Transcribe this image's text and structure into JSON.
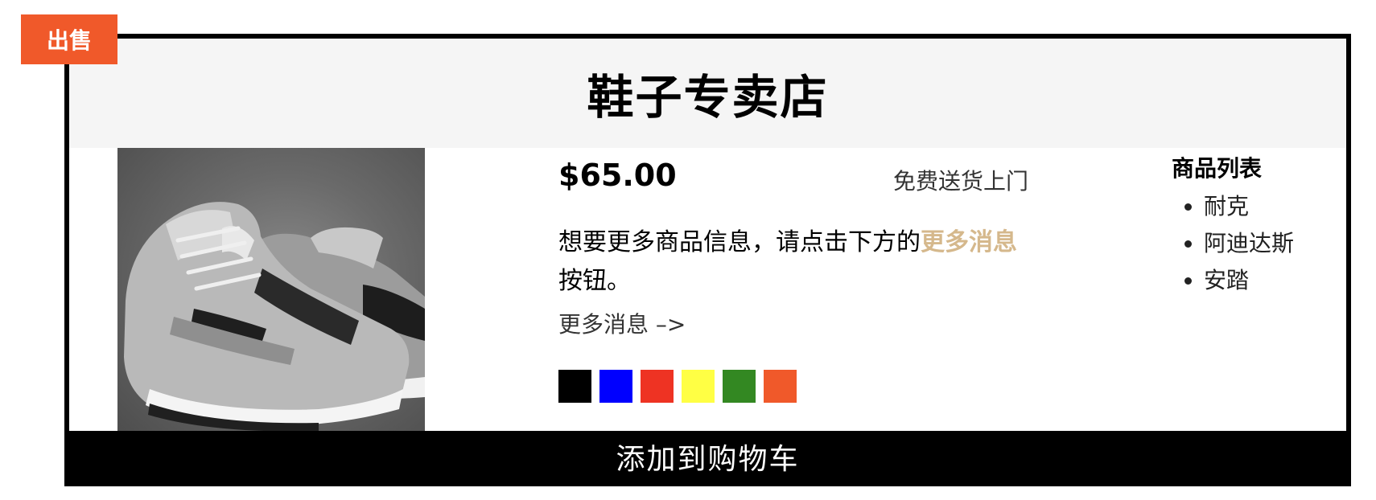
{
  "badge": {
    "label": "出售",
    "color": "#f0592a"
  },
  "store": {
    "title": "鞋子专卖店"
  },
  "product": {
    "price": "$65.00",
    "shipping": "免费送货上门",
    "description_before": "想要更多商品信息，请点击下方的",
    "description_highlight": "更多消息",
    "description_after": "按钮。",
    "more_link": "更多消息 –>",
    "swatches": [
      "#000000",
      "#0000ff",
      "#ee3323",
      "#ffff44",
      "#338822",
      "#f0592a"
    ]
  },
  "product_list": {
    "title": "商品列表",
    "items": [
      "耐克",
      "阿迪达斯",
      "安踏"
    ]
  },
  "cart": {
    "label": "添加到购物车"
  }
}
